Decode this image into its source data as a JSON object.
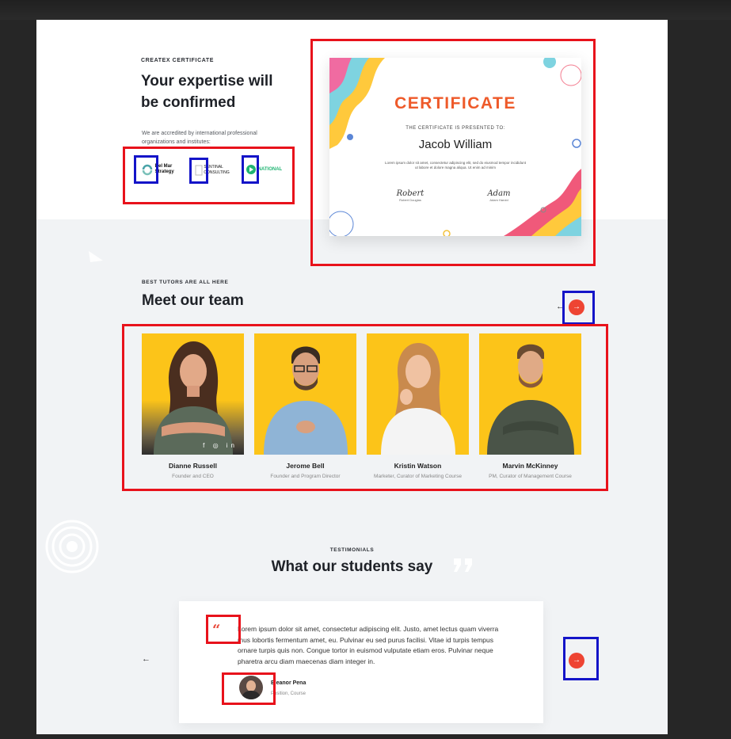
{
  "certificate_section": {
    "eyebrow": "CREATEX CERTIFICATE",
    "title_line1": "Your expertise will",
    "title_line2": "be confirmed",
    "description_line1": "We are accredited by international professional",
    "description_line2": "organizations and institutes:",
    "logos": [
      {
        "label_line1": "Del Mar",
        "label_line2": "Strategy"
      },
      {
        "label_line1": "SENTINAL",
        "label_line2": "CONSULTING"
      },
      {
        "label_line1": "NATIONAL",
        "label_line2": ""
      }
    ]
  },
  "certificate_card": {
    "title": "CERTIFICATE",
    "subtitle": "THE CERTIFICATE IS PRESENTED TO:",
    "recipient": "Jacob William",
    "body": "Lorem ipsum dolor sit amet, consectetur adipiscing elit, sed do eiusmod tempor incididunt ut labore et dolore magna aliqua. Ut enim ad minim",
    "signatures": [
      {
        "script": "Robert",
        "name": "Robert Douglas"
      },
      {
        "script": "Adam",
        "name": "Adam Harold"
      }
    ]
  },
  "team_section": {
    "eyebrow": "BEST TUTORS ARE ALL HERE",
    "title": "Meet our team",
    "prev_arrow": "←",
    "next_arrow": "→",
    "members": [
      {
        "name": "Dianne Russell",
        "role": "Founder and CEO",
        "socials": "f ◎ in"
      },
      {
        "name": "Jerome Bell",
        "role": "Founder and Program Director"
      },
      {
        "name": "Kristin Watson",
        "role": "Marketer, Curator of Marketing Course"
      },
      {
        "name": "Marvin McKinney",
        "role": "PM, Curator of Management Course"
      }
    ]
  },
  "testimonials_section": {
    "eyebrow": "TESTIMONIALS",
    "title": "What our students say",
    "prev_arrow": "←",
    "next_arrow": "→",
    "quote": "Lorem ipsum dolor sit amet, consectetur adipiscing elit. Justo, amet lectus quam viverra mus lobortis fermentum amet, eu. Pulvinar eu sed purus facilisi. Vitae id turpis tempus ornare turpis quis non. Congue tortor in euismod vulputate etiam eros. Pulvinar neque pharetra arcu diam maecenas diam integer in.",
    "quote_mark": "“",
    "author_name": "Eleanor Pena",
    "author_role": "Position, Course"
  },
  "colors": {
    "accent": "#ee4433",
    "member_bg": "#fcc419",
    "annotation_red": "#e8121b",
    "annotation_blue": "#1414c8"
  }
}
